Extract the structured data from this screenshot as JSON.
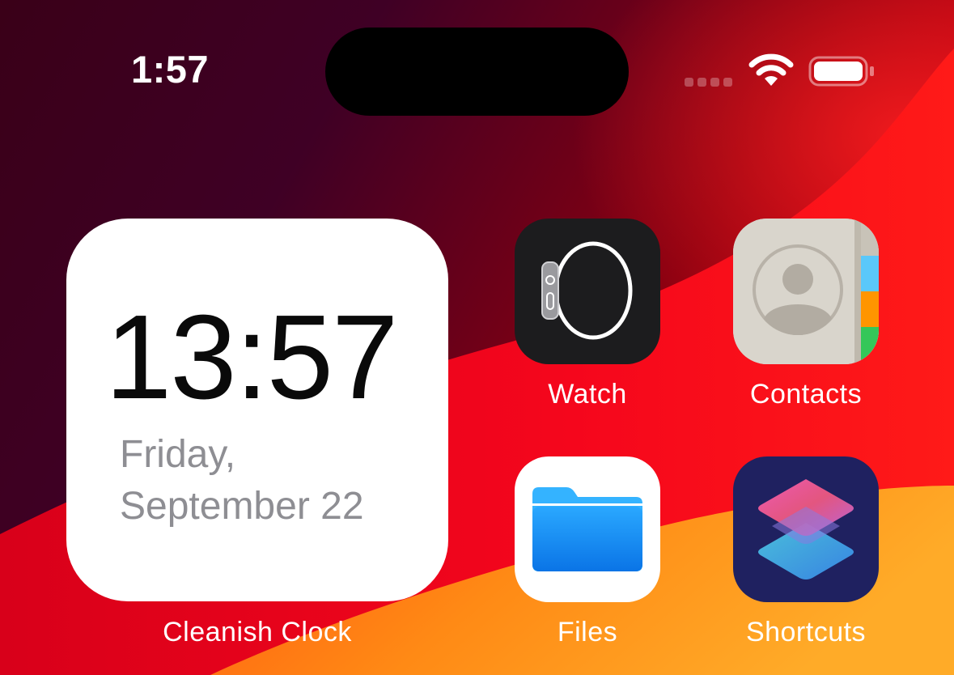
{
  "status_bar": {
    "time": "1:57"
  },
  "widget": {
    "time": "13:57",
    "day": "Friday,",
    "date": "September 22",
    "label": "Cleanish Clock"
  },
  "apps": {
    "watch": {
      "label": "Watch",
      "icon": "watch-icon"
    },
    "contacts": {
      "label": "Contacts",
      "icon": "contacts-icon"
    },
    "files": {
      "label": "Files",
      "icon": "files-icon"
    },
    "shortcuts": {
      "label": "Shortcuts",
      "icon": "shortcuts-icon"
    }
  },
  "colors": {
    "wallpaper_dark": "#3d0024",
    "wallpaper_red": "#e8001a",
    "wallpaper_orange": "#ff9d1a",
    "files_blue": "#1e8cf5",
    "shortcuts_bg": "#1f2160"
  }
}
